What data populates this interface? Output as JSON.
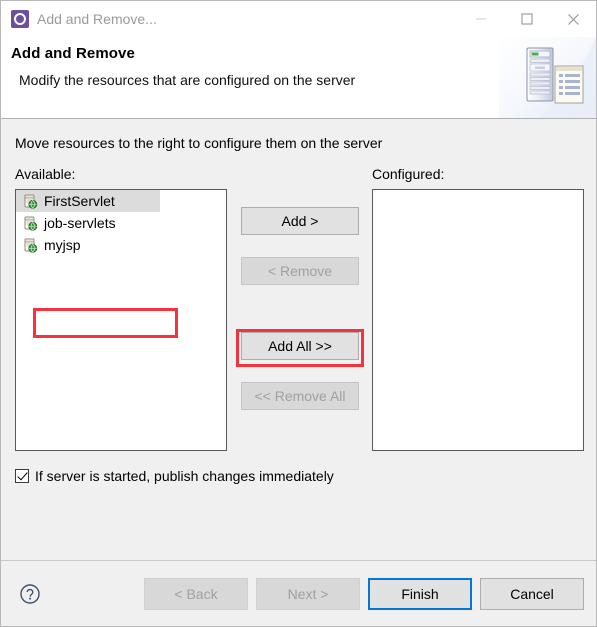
{
  "window": {
    "title": "Add and Remove...",
    "icon": "server-gear-icon",
    "controls": {
      "minimize": "minimize-icon",
      "maximize": "maximize-icon",
      "close": "close-icon"
    }
  },
  "header": {
    "title": "Add and Remove",
    "subtitle": "Modify the resources that are configured on the server",
    "art": "server-and-document-illustration"
  },
  "main": {
    "instruction": "Move resources to the right to configure them on the server",
    "available": {
      "label": "Available:",
      "items": [
        {
          "name": "FirstServlet",
          "icon": "web-module-icon",
          "selected": true
        },
        {
          "name": "job-servlets",
          "icon": "web-module-icon",
          "selected": false
        },
        {
          "name": "myjsp",
          "icon": "web-module-icon",
          "selected": false
        }
      ]
    },
    "configured": {
      "label": "Configured:",
      "items": []
    },
    "transfer_buttons": [
      {
        "label": "Add >",
        "enabled": true,
        "highlighted": true
      },
      {
        "label": "< Remove",
        "enabled": false,
        "highlighted": false
      },
      {
        "label": "Add All >>",
        "enabled": true,
        "highlighted": false
      },
      {
        "label": "<< Remove All",
        "enabled": false,
        "highlighted": false
      }
    ],
    "publish_checkbox": {
      "label": "If server is started, publish changes immediately",
      "checked": true
    }
  },
  "footer": {
    "help": "help-icon",
    "buttons": [
      {
        "label": "< Back",
        "enabled": false,
        "primary": false
      },
      {
        "label": "Next >",
        "enabled": false,
        "primary": false
      },
      {
        "label": "Finish",
        "enabled": true,
        "primary": true
      },
      {
        "label": "Cancel",
        "enabled": true,
        "primary": false
      }
    ]
  },
  "annotations": {
    "color": "#f5333f",
    "regions": [
      "available-first-item",
      "add-button"
    ]
  },
  "colors": {
    "dialog_bg": "#f0f0f0",
    "header_bg": "#ffffff",
    "accent_focus": "#0078d7",
    "selection_bg": "#dcdcdc",
    "annotation": "#f5333f",
    "title_text": "#9a9a9a"
  }
}
